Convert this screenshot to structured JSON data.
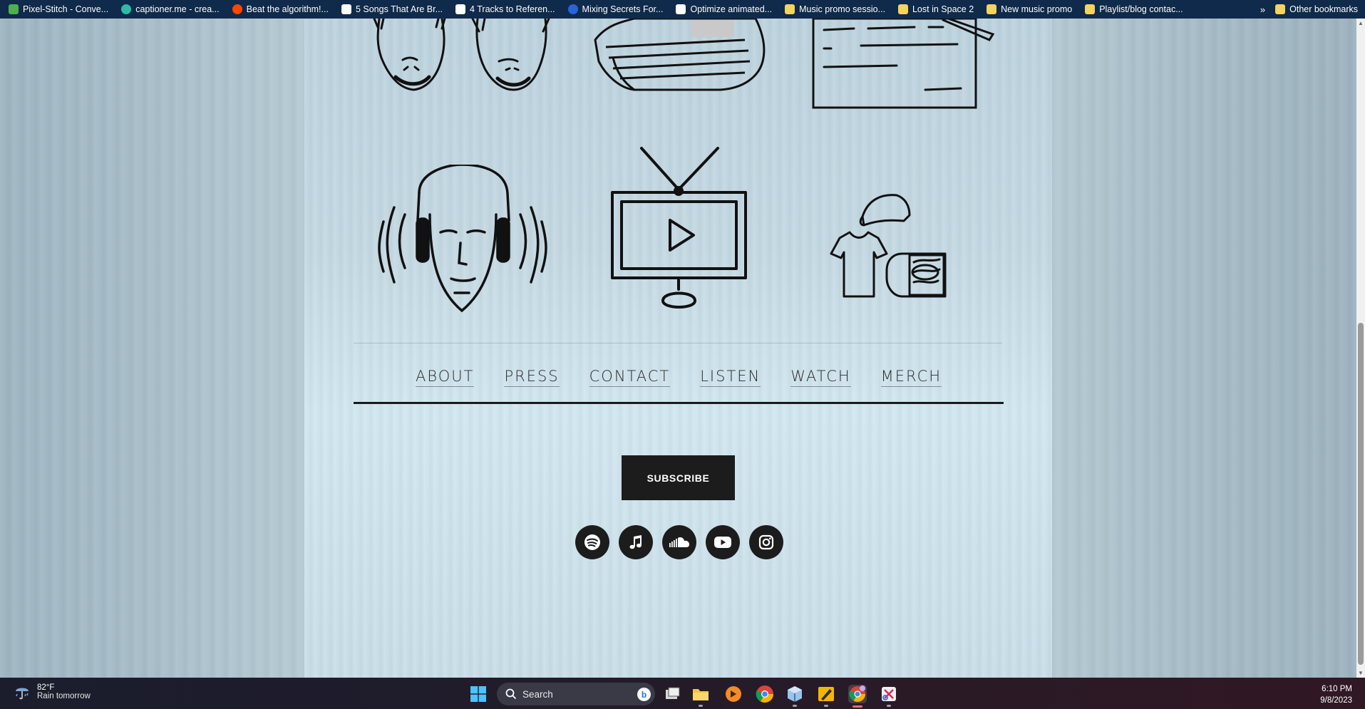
{
  "bookmarks": [
    {
      "label": "Pixel-Stitch - Conve...",
      "icon": "pixel-stitch-icon",
      "color": "#4caf50"
    },
    {
      "label": "captioner.me - crea...",
      "icon": "captioner-icon",
      "color": "#2fb9a8"
    },
    {
      "label": "Beat the algorithm!...",
      "icon": "reddit-icon",
      "color": "#ff4500"
    },
    {
      "label": "5 Songs That Are Br...",
      "icon": "site-icon",
      "color": "#ffffff"
    },
    {
      "label": "4 Tracks to Referen...",
      "icon": "site-icon",
      "color": "#ffffff"
    },
    {
      "label": "Mixing Secrets For...",
      "icon": "mixing-icon",
      "color": "#2a63d9"
    },
    {
      "label": "Optimize animated...",
      "icon": "doc-icon",
      "color": "#ffffff"
    },
    {
      "label": "Music promo sessio...",
      "icon": "note-icon",
      "color": "#f4d35e"
    },
    {
      "label": "Lost in Space 2",
      "icon": "note-icon",
      "color": "#f4d35e"
    },
    {
      "label": "New music promo",
      "icon": "note-icon",
      "color": "#f4d35e"
    },
    {
      "label": "Playlist/blog contac...",
      "icon": "note-icon",
      "color": "#f4d35e"
    }
  ],
  "bookmarks_overflow": "»",
  "other_bookmarks": "Other bookmarks",
  "nav": [
    {
      "label": "ABOUT"
    },
    {
      "label": "PRESS"
    },
    {
      "label": "CONTACT"
    },
    {
      "label": "LISTEN"
    },
    {
      "label": "WATCH"
    },
    {
      "label": "MERCH"
    }
  ],
  "subscribe_label": "SUBSCRIBE",
  "socials": [
    "spotify-icon",
    "apple-music-icon",
    "soundcloud-icon",
    "youtube-icon",
    "instagram-icon"
  ],
  "taskbar": {
    "weather_temp": "82°F",
    "weather_desc": "Rain tomorrow",
    "search_placeholder": "Search",
    "time": "6:10 PM",
    "date": "9/8/2023"
  }
}
